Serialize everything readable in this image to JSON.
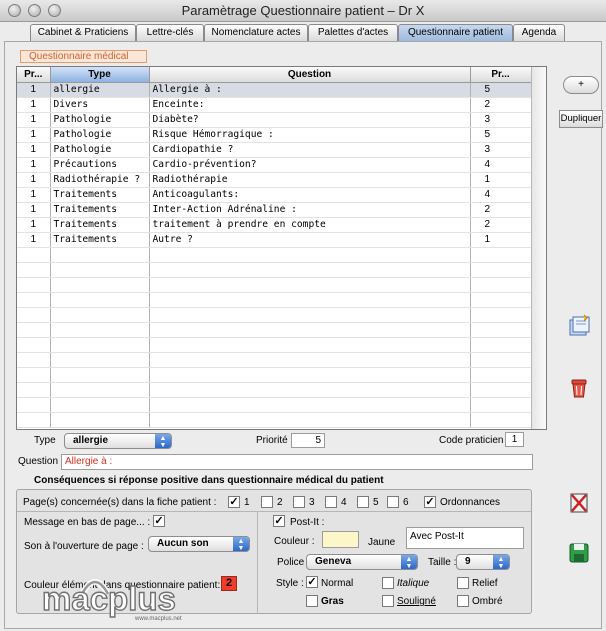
{
  "window": {
    "title": "Paramètrage Questionnaire patient – Dr X"
  },
  "tabs": [
    {
      "label": "Cabinet & Praticiens"
    },
    {
      "label": "Lettre-clés"
    },
    {
      "label": "Nomenclature actes"
    },
    {
      "label": "Palettes d'actes"
    },
    {
      "label": "Questionnaire patient"
    },
    {
      "label": "Agenda"
    }
  ],
  "section": {
    "label": "Questionnaire médical"
  },
  "table": {
    "headers": [
      "Pr...",
      "Type",
      "Question",
      "Pr..."
    ],
    "rows": [
      {
        "pr1": "1",
        "type": "allergie",
        "question": "Allergie à :",
        "pr2": "5"
      },
      {
        "pr1": "1",
        "type": "Divers",
        "question": "Enceinte:",
        "pr2": "2"
      },
      {
        "pr1": "1",
        "type": "Pathologie",
        "question": "Diabète?",
        "pr2": "3"
      },
      {
        "pr1": "1",
        "type": "Pathologie",
        "question": "Risque Hémorragique :",
        "pr2": "5"
      },
      {
        "pr1": "1",
        "type": "Pathologie",
        "question": "Cardiopathie ?",
        "pr2": "3"
      },
      {
        "pr1": "1",
        "type": "Précautions",
        "question": "Cardio-prévention?",
        "pr2": "4"
      },
      {
        "pr1": "1",
        "type": "Radiothérapie ?",
        "question": "Radiothérapie",
        "pr2": "1"
      },
      {
        "pr1": "1",
        "type": "Traitements",
        "question": "Anticoagulants:",
        "pr2": "4"
      },
      {
        "pr1": "1",
        "type": "Traitements",
        "question": "Inter-Action Adrénaline :",
        "pr2": "2"
      },
      {
        "pr1": "1",
        "type": "Traitements",
        "question": "traitement à prendre en compte",
        "pr2": "2"
      },
      {
        "pr1": "1",
        "type": "Traitements",
        "question": "Autre ?",
        "pr2": "1"
      }
    ]
  },
  "side": {
    "add_label": "+",
    "duplicate_label": "Dupliquer"
  },
  "form": {
    "type_label": "Type",
    "type_value": "allergie",
    "priority_label": "Priorité",
    "priority_value": "5",
    "code_label": "Code praticien",
    "code_value": "1",
    "question_label": "Question",
    "question_value": "Allergie à :",
    "question_color": "#d0301e"
  },
  "consequences": {
    "title": "Conséquences si réponse positive dans questionnaire médical du patient",
    "pages_label": "Page(s) concernée(s) dans la fiche patient :",
    "pages": [
      "1",
      "2",
      "3",
      "4",
      "5",
      "6"
    ],
    "ordonnances_label": "Ordonnances",
    "message_label": "Message en bas de page... :",
    "sound_label": "Son à l'ouverture de page :",
    "sound_value": "Aucun son",
    "color_label": "Couleur élément dans questionnaire patient:",
    "color_value": "2",
    "color_swatch": "#ef3d2a"
  },
  "postit": {
    "label": "Post-It :",
    "color_label": "Couleur :",
    "color_name": "Jaune",
    "swatch": "#fdf6c8",
    "text_value": "Avec Post-It",
    "font_label": "Police :",
    "font_value": "Geneva",
    "size_label": "Taille :",
    "size_value": "9",
    "style_label": "Style :",
    "styles": {
      "normal": "Normal",
      "italic": "Italique",
      "relief": "Relief",
      "bold": "Gras",
      "underline": "Souligné",
      "shadow": "Ombré"
    }
  },
  "icons": [
    "copy-icon",
    "trash-icon",
    "delete-icon",
    "save-icon"
  ],
  "watermark": {
    "brand": "macplus",
    "url": "www.macplus.net"
  }
}
